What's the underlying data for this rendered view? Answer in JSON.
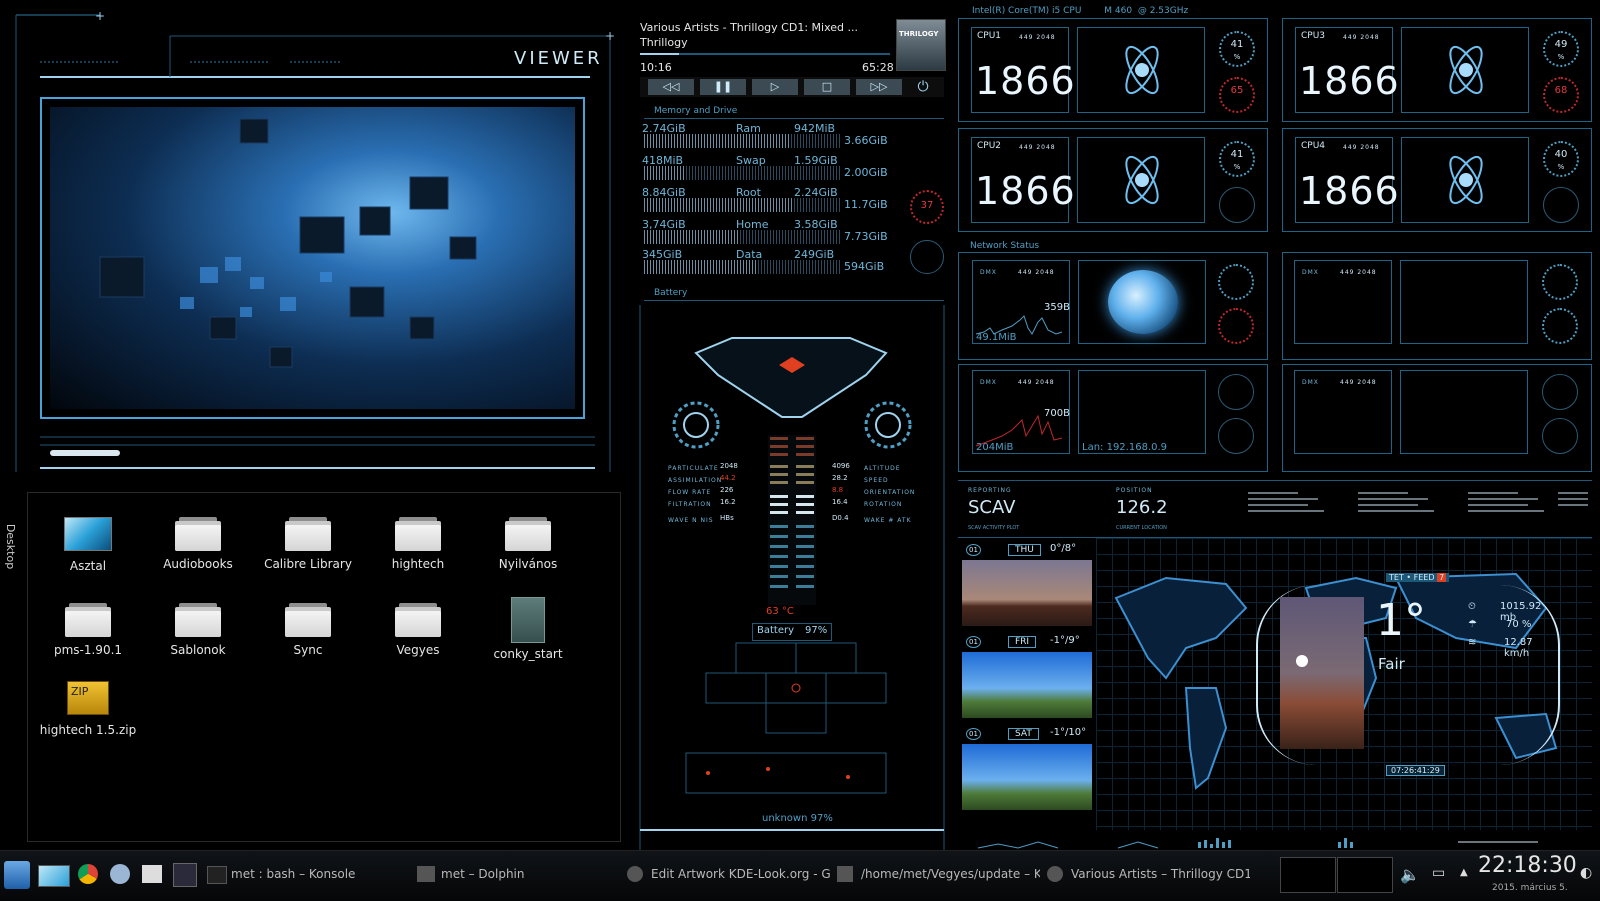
{
  "viewer": {
    "title": "VIEWER"
  },
  "desktop": {
    "side_label": "Desktop",
    "icons": [
      {
        "label": "Asztal",
        "icon": "desktop-icon"
      },
      {
        "label": "Audiobooks",
        "icon": "folder-icon"
      },
      {
        "label": "Calibre Library",
        "icon": "folder-icon"
      },
      {
        "label": "hightech",
        "icon": "folder-icon"
      },
      {
        "label": "Nyilvános",
        "icon": "folder-icon"
      },
      {
        "label": "pms-1.90.1",
        "icon": "folder-icon"
      },
      {
        "label": "Sablonok",
        "icon": "folder-icon"
      },
      {
        "label": "Sync",
        "icon": "folder-icon"
      },
      {
        "label": "Vegyes",
        "icon": "folder-icon"
      },
      {
        "label": "conky_start",
        "icon": "script-icon"
      },
      {
        "label": "hightech 1.5.zip",
        "icon": "zip-icon"
      }
    ]
  },
  "player": {
    "track": "Various Artists - Thrillogy CD1: Mixed ...",
    "album": "Thrillogy",
    "art_text": "THRILOGY",
    "elapsed": "10:16",
    "total": "65:28"
  },
  "memory": {
    "section": "Memory and Drive",
    "rows": [
      {
        "used": "2.74GiB",
        "label": "Ram",
        "free": "942MiB",
        "total": "3.66GiB",
        "fill": 0.75
      },
      {
        "used": "418MiB",
        "label": "Swap",
        "free": "1.59GiB",
        "total": "2.00GiB",
        "fill": 0.21
      },
      {
        "used": "8.84GiB",
        "label": "Root",
        "free": "2.24GiB",
        "total": "11.7GiB",
        "fill": 0.76
      },
      {
        "used": "3,74GiB",
        "label": "Home",
        "free": "3.58GiB",
        "total": "7.73GiB",
        "fill": 0.48
      },
      {
        "used": "345GiB",
        "label": "Data",
        "free": "249GiB",
        "total": "594GiB",
        "fill": 0.58
      }
    ],
    "drive_temp": "37",
    "battery_section": "Battery"
  },
  "center": {
    "temp": "63 °C",
    "battery_label": "Battery",
    "battery_value": "97%",
    "unknown": "unknown 97%",
    "left_labels": [
      "PARTICULATE",
      "ASSIMILATION",
      "FLOW RATE",
      "FILTRATION",
      "WAVE N NIS"
    ],
    "left_values": [
      "2048",
      "44.2",
      "226",
      "16.2",
      "HBs"
    ],
    "right_values": [
      "4096",
      "28.2",
      "8.8",
      "16.4",
      "D0.4"
    ],
    "right_labels": [
      "ALTITUDE",
      "SPEED",
      "ORIENTATION",
      "ROTATION",
      "WAKE # ATK"
    ]
  },
  "cpu": {
    "header": "Intel(R) Core(TM) i5 CPU        M 460  @ 2.53GHz",
    "cores": [
      {
        "name": "CPU1",
        "freq": "1866",
        "meta": "449 2048",
        "load": "41",
        "temp": "65"
      },
      {
        "name": "CPU2",
        "freq": "1866",
        "meta": "449 2048",
        "load": "41",
        "temp": ""
      },
      {
        "name": "CPU3",
        "freq": "1866",
        "meta": "449 2048",
        "load": "49",
        "temp": "68"
      },
      {
        "name": "CPU4",
        "freq": "1866",
        "meta": "449 2048",
        "load": "40",
        "temp": ""
      }
    ],
    "unit": "%"
  },
  "network": {
    "section": "Network Status",
    "dmx": "DMX",
    "meta": "449 2048",
    "down_rate": "359B",
    "down_total": "49.1MiB",
    "up_rate": "700B",
    "up_total": "204MiB",
    "lan": "Lan: 192.168.0.9"
  },
  "nav": {
    "reporting_label": "REPORTING",
    "reporting_value": "SCAV",
    "reporting_sub": "SCAV ACTIVITY PLOT",
    "position_label": "POSITION",
    "position_value": "126.2",
    "position_sub": "CURRENT LOCATION"
  },
  "weather": {
    "days": [
      {
        "num": "01",
        "day": "THU",
        "range": "0°/8°"
      },
      {
        "num": "01",
        "day": "FRI",
        "range": "-1°/9°"
      },
      {
        "num": "01",
        "day": "SAT",
        "range": "-1°/10°"
      }
    ],
    "current_temp": "1°",
    "condition": "Fair",
    "pressure": "1015.92 mb",
    "humidity": "70 %",
    "wind": "12.87 km/h",
    "feed_label": "TET",
    "feed": "FEED",
    "feed_num": "7",
    "time": "07:26:41:29"
  },
  "taskbar": {
    "tasks": [
      {
        "label": "met : bash – Konsole",
        "icon": "terminal-icon"
      },
      {
        "label": "met – Dolphin",
        "icon": "folder-icon"
      },
      {
        "label": "Edit  Artwork KDE-Look.org - G",
        "icon": "browser-icon"
      },
      {
        "label": "/home/met/Vegyes/update – K",
        "icon": "editor-icon"
      },
      {
        "label": "Various Artists – Thrillogy CD1",
        "icon": "music-icon"
      }
    ],
    "clock": "22:18:30",
    "date": "2015. március 5."
  }
}
